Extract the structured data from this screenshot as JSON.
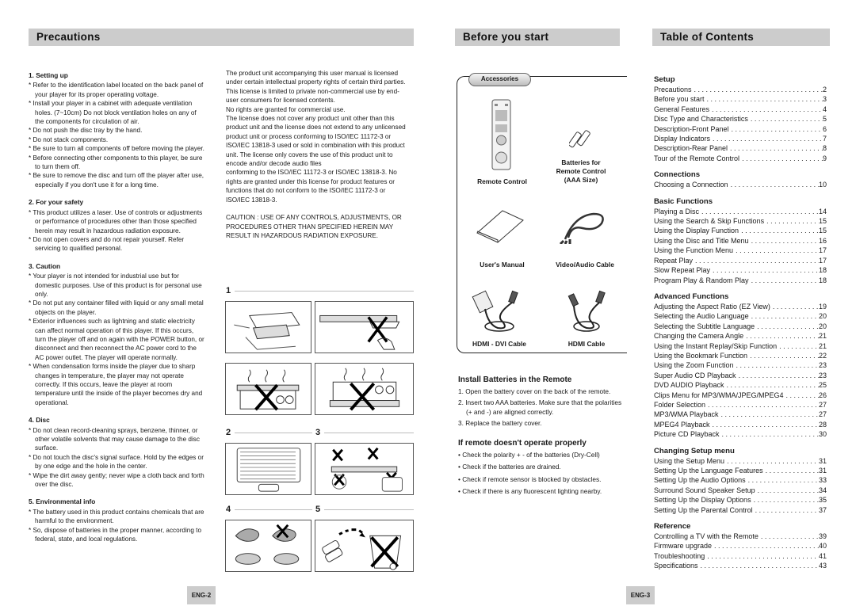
{
  "headers": {
    "precautions": "Precautions",
    "before_you_start": "Before you start",
    "table_of_contents": "Table of Contents"
  },
  "precautions": {
    "sections": [
      {
        "title": "1. Setting up",
        "bullets": [
          "* Refer to the identification label located on the back panel of your player for its proper operating voltage.",
          "* Install your player in a cabinet with adequate ventilation holes. (7~10cm) Do not block ventilation holes on any of the components for circulation of air.",
          "* Do not push the disc tray by the hand.",
          "* Do not stack components.",
          "* Be sure to turn all components off before moving the player.",
          "* Before connecting other components to this player, be sure to turn them off.",
          "* Be sure to remove the disc and turn off the player after use, especially if you don't use it for a long time."
        ]
      },
      {
        "title": "2. For your safety",
        "bullets": [
          "* This product utilizes a laser. Use of controls or adjustments or performance of procedures other than those specified herein may result in hazardous radiation exposure.",
          "* Do not open covers and do not repair yourself. Refer servicing to qualified personal."
        ]
      },
      {
        "title": "3. Caution",
        "bullets": [
          "* Your player is not intended for industrial use but for domestic purposes. Use of this product is for personal use only.",
          "* Do not put any container filled with liquid or any small metal objects on the player.",
          "* Exterior influences such as lightning and static electricity can affect normal operation of this player. If this occurs, turn the player off and on again with the POWER button, or disconnect and then reconnect the AC power cord to the AC power outlet. The player will operate normally.",
          "* When condensation forms inside the player due to sharp changes in temperature, the player may not operate correctly. If this occurs, leave the player at room temperature until the inside of the player becomes dry and operational."
        ]
      },
      {
        "title": "4. Disc",
        "bullets": [
          "* Do not clean record-cleaning sprays, benzene, thinner, or other volatile solvents that may cause damage to the disc surface.",
          "* Do not touch the disc's signal surface. Hold by the edges or by one edge and the hole in the center.",
          "* Wipe the dirt away gently; never wipe a cloth back and forth over the disc."
        ]
      },
      {
        "title": "5. Environmental info",
        "bullets": [
          "* The battery used in this product contains chemicals that are harmful to the environment.",
          "* So, dispose of batteries in the proper manner, according to federal, state, and local regulations."
        ]
      }
    ],
    "license_paragraphs": [
      "The product unit accompanying this user manual is licensed under certain intellectual property rights of certain third parties. This license is limited to private non-commercial use by end-user consumers for licensed contents.",
      "No rights are granted for commercial use.",
      "The license does not cover any product unit other than this product unit and the license does not extend to any unlicensed product unit or process conforming to ISO/IEC 11172-3 or ISO/IEC 13818-3 used or sold in combination with this product unit. The license only covers the use of this product unit to encode and/or decode audio files",
      "conforming to the ISO/IEC 11172-3 or ISO/IEC 13818-3. No rights are granted under this license for product features or functions that do not conform to the ISO/IEC 11172-3 or ISO/IEC 13818-3."
    ],
    "caution_text": "CAUTION : USE OF ANY CONTROLS, ADJUSTMENTS, OR PROCEDURES OTHER THAN SPECIFIED HEREIN MAY RESULT IN HAZARDOUS RADIATION EXPOSURE.",
    "figure_labels": [
      "1",
      "2",
      "3",
      "4",
      "5"
    ]
  },
  "before_you_start": {
    "accessories_label": "Accessories",
    "accessories": [
      {
        "name": "Remote Control",
        "icon": "remote-control-icon"
      },
      {
        "name": "Batteries for Remote Control (AAA Size)",
        "icon": "batteries-icon"
      },
      {
        "name": "User's Manual",
        "icon": "manual-icon"
      },
      {
        "name": "Video/Audio Cable",
        "icon": "av-cable-icon"
      },
      {
        "name": "HDMI - DVI Cable",
        "icon": "hdmi-dvi-cable-icon"
      },
      {
        "name": "HDMI Cable",
        "icon": "hdmi-cable-icon"
      }
    ],
    "install_title": "Install Batteries in the Remote",
    "install_steps": [
      "1. Open the battery cover on the back of the remote.",
      "2. Insert two AAA batteries. Make sure that the polarities (+ and -) are aligned correctly.",
      "3. Replace the battery cover."
    ],
    "trouble_title": "If remote doesn't operate properly",
    "trouble_checks": [
      "• Check the polarity + - of the batteries (Dry-Cell)",
      "• Check if the batteries are drained.",
      "• Check if remote sensor is blocked by obstacles.",
      "• Check if there is any fluorescent lighting nearby."
    ]
  },
  "toc": [
    {
      "title": "Setup",
      "items": [
        {
          "t": "Precautions",
          "p": "2"
        },
        {
          "t": "Before you start",
          "p": "3"
        },
        {
          "t": "General Features",
          "p": "4"
        },
        {
          "t": "Disc Type and Characteristics",
          "p": "5"
        },
        {
          "t": "Description-Front Panel",
          "p": "6"
        },
        {
          "t": "Display Indicators",
          "p": "7"
        },
        {
          "t": "Description-Rear Panel",
          "p": "8"
        },
        {
          "t": "Tour of the Remote Control",
          "p": "9"
        }
      ]
    },
    {
      "title": "Connections",
      "items": [
        {
          "t": "Choosing a Connection",
          "p": "10"
        }
      ]
    },
    {
      "title": "Basic Functions",
      "items": [
        {
          "t": "Playing a Disc",
          "p": "14"
        },
        {
          "t": "Using the Search & Skip Functions",
          "p": "15"
        },
        {
          "t": "Using the Display Function",
          "p": "15"
        },
        {
          "t": "Using the Disc and Title Menu",
          "p": "16"
        },
        {
          "t": "Using the Function Menu",
          "p": "17"
        },
        {
          "t": "Repeat Play",
          "p": "17"
        },
        {
          "t": "Slow Repeat Play",
          "p": "18"
        },
        {
          "t": "Program Play & Random Play",
          "p": "18"
        }
      ]
    },
    {
      "title": "Advanced Functions",
      "items": [
        {
          "t": "Adjusting the Aspect Ratio (EZ View)",
          "p": "19"
        },
        {
          "t": "Selecting the Audio Language",
          "p": "20"
        },
        {
          "t": "Selecting the Subtitle Language",
          "p": "20"
        },
        {
          "t": "Changing the Camera Angle",
          "p": "21"
        },
        {
          "t": "Using the Instant Replay/Skip Function",
          "p": "21"
        },
        {
          "t": "Using the Bookmark Function",
          "p": "22"
        },
        {
          "t": "Using the Zoom Function",
          "p": "23"
        },
        {
          "t": "Super Audio CD Playback",
          "p": "23"
        },
        {
          "t": "DVD AUDIO Playback",
          "p": "25"
        },
        {
          "t": "Clips Menu for MP3/WMA/JPEG/MPEG4",
          "p": "26"
        },
        {
          "t": "Folder Selection",
          "p": "27"
        },
        {
          "t": "MP3/WMA Playback",
          "p": "27"
        },
        {
          "t": "MPEG4 Playback",
          "p": "28"
        },
        {
          "t": "Picture CD Playback",
          "p": "30"
        }
      ]
    },
    {
      "title": "Changing Setup menu",
      "items": [
        {
          "t": "Using the Setup Menu",
          "p": "31"
        },
        {
          "t": "Setting Up the Language Features",
          "p": "31"
        },
        {
          "t": "Setting Up the Audio Options",
          "p": "33"
        },
        {
          "t": "Surround Sound Speaker Setup",
          "p": "34"
        },
        {
          "t": "Setting Up the Display Options",
          "p": "35"
        },
        {
          "t": "Setting Up the Parental Control",
          "p": "37"
        }
      ]
    },
    {
      "title": "Reference",
      "items": [
        {
          "t": "Controlling a TV with the Remote",
          "p": "39"
        },
        {
          "t": "Firmware upgrade",
          "p": "40"
        },
        {
          "t": "Troubleshooting",
          "p": "41"
        },
        {
          "t": "Specifications",
          "p": "43"
        }
      ]
    }
  ],
  "page_numbers": {
    "left": "ENG-2",
    "right": "ENG-3"
  }
}
